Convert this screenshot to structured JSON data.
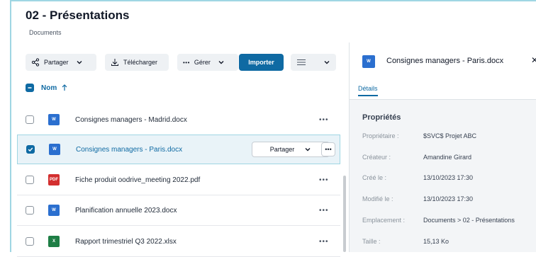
{
  "page": {
    "title": "02 - Présentations",
    "breadcrumb": "Documents"
  },
  "toolbar": {
    "share_label": "Partager",
    "download_label": "Télécharger",
    "manage_label": "Gérer",
    "import_label": "Importer"
  },
  "list": {
    "header": {
      "name_label": "Nom",
      "sort": "ascending"
    },
    "rows": [
      {
        "name": "Consignes managers - Madrid.docx",
        "type": "word",
        "icon_text": "W",
        "selected": false
      },
      {
        "name": "Consignes managers - Paris.docx",
        "type": "word",
        "icon_text": "W",
        "selected": true,
        "share_label": "Partager"
      },
      {
        "name": "Fiche produit oodrive_meeting 2022.pdf",
        "type": "pdf",
        "icon_text": "PDF",
        "selected": false
      },
      {
        "name": "Planification annuelle 2023.docx",
        "type": "word",
        "icon_text": "W",
        "selected": false
      },
      {
        "name": "Rapport trimestriel Q3 2022.xlsx",
        "type": "excel",
        "icon_text": "X",
        "selected": false
      }
    ]
  },
  "details": {
    "file_name": "Consignes managers - Paris.docx",
    "file_icon_text": "W",
    "tab_label": "Détails",
    "section_title": "Propriétés",
    "properties": [
      {
        "label": "Propriétaire :",
        "value": "$SVC$ Projet ABC"
      },
      {
        "label": "Créateur :",
        "value": "Amandine Girard"
      },
      {
        "label": "Créé le :",
        "value": "13/10/2023 17:30"
      },
      {
        "label": "Modifié le :",
        "value": "13/10/2023 17:30"
      },
      {
        "label": "Emplacement :",
        "value": "Documents > 02 - Présentations"
      },
      {
        "label": "Taille :",
        "value": "15,13 Ko"
      }
    ]
  },
  "colors": {
    "accent": "#0f6aa3",
    "selected_bg": "#e9f3f8",
    "word": "#2b6fcf",
    "pdf": "#d32f2f",
    "excel": "#1e7e45"
  },
  "icons": [
    "share-icon",
    "chevron-down-icon",
    "download-icon",
    "more-icon",
    "list-view-icon",
    "sort-up-icon",
    "checkbox-icon",
    "word-file-icon",
    "pdf-file-icon",
    "excel-file-icon",
    "close-icon"
  ]
}
